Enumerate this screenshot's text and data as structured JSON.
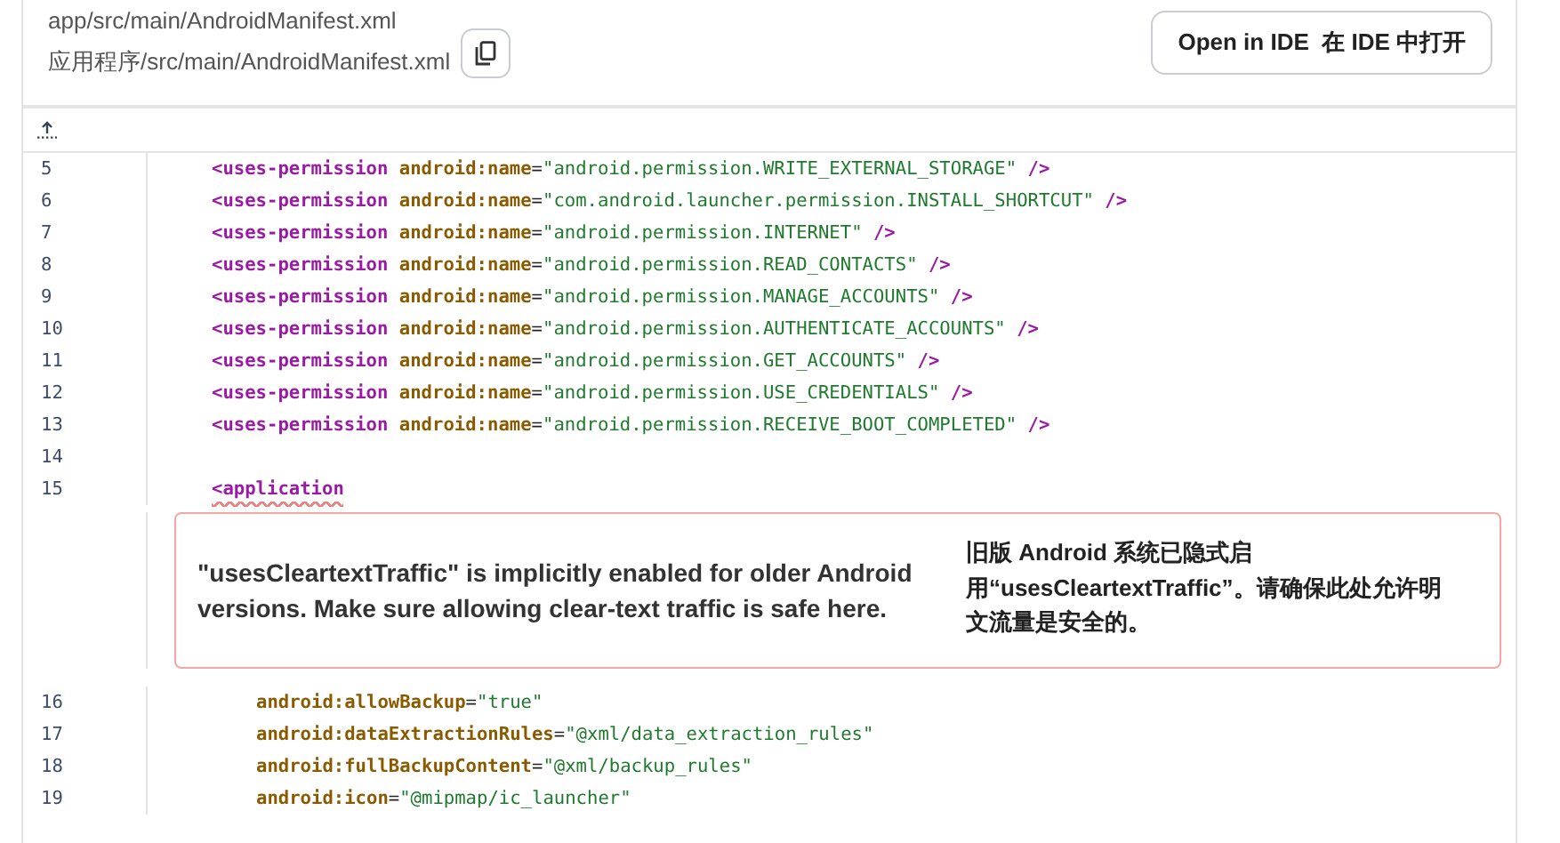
{
  "header": {
    "path": "app/src/main/AndroidManifest.xml",
    "path_translated": "应用程序/src/main/AndroidManifest.xml",
    "open_button": "Open in IDE  在 IDE 中打开"
  },
  "code": {
    "lines": [
      {
        "number": "5",
        "kind": "element",
        "tokens": [
          {
            "kind": "tag",
            "text": "<uses-permission"
          },
          {
            "kind": "attr",
            "text": " android:name"
          },
          {
            "kind": "punct",
            "text": "="
          },
          {
            "kind": "value",
            "text": "\"android.permission.WRITE_EXTERNAL_STORAGE\""
          },
          {
            "kind": "tag",
            "text": " />"
          }
        ]
      },
      {
        "number": "6",
        "kind": "element",
        "tokens": [
          {
            "kind": "tag",
            "text": "<uses-permission"
          },
          {
            "kind": "attr",
            "text": " android:name"
          },
          {
            "kind": "punct",
            "text": "="
          },
          {
            "kind": "value",
            "text": "\"com.android.launcher.permission.INSTALL_SHORTCUT\""
          },
          {
            "kind": "tag",
            "text": " />"
          }
        ]
      },
      {
        "number": "7",
        "kind": "element",
        "tokens": [
          {
            "kind": "tag",
            "text": "<uses-permission"
          },
          {
            "kind": "attr",
            "text": " android:name"
          },
          {
            "kind": "punct",
            "text": "="
          },
          {
            "kind": "value",
            "text": "\"android.permission.INTERNET\""
          },
          {
            "kind": "tag",
            "text": " />"
          }
        ]
      },
      {
        "number": "8",
        "kind": "element",
        "tokens": [
          {
            "kind": "tag",
            "text": "<uses-permission"
          },
          {
            "kind": "attr",
            "text": " android:name"
          },
          {
            "kind": "punct",
            "text": "="
          },
          {
            "kind": "value",
            "text": "\"android.permission.READ_CONTACTS\""
          },
          {
            "kind": "tag",
            "text": " />"
          }
        ]
      },
      {
        "number": "9",
        "kind": "element",
        "tokens": [
          {
            "kind": "tag",
            "text": "<uses-permission"
          },
          {
            "kind": "attr",
            "text": " android:name"
          },
          {
            "kind": "punct",
            "text": "="
          },
          {
            "kind": "value",
            "text": "\"android.permission.MANAGE_ACCOUNTS\""
          },
          {
            "kind": "tag",
            "text": " />"
          }
        ]
      },
      {
        "number": "10",
        "kind": "element",
        "tokens": [
          {
            "kind": "tag",
            "text": "<uses-permission"
          },
          {
            "kind": "attr",
            "text": " android:name"
          },
          {
            "kind": "punct",
            "text": "="
          },
          {
            "kind": "value",
            "text": "\"android.permission.AUTHENTICATE_ACCOUNTS\""
          },
          {
            "kind": "tag",
            "text": " />"
          }
        ]
      },
      {
        "number": "11",
        "kind": "element",
        "tokens": [
          {
            "kind": "tag",
            "text": "<uses-permission"
          },
          {
            "kind": "attr",
            "text": " android:name"
          },
          {
            "kind": "punct",
            "text": "="
          },
          {
            "kind": "value",
            "text": "\"android.permission.GET_ACCOUNTS\""
          },
          {
            "kind": "tag",
            "text": " />"
          }
        ]
      },
      {
        "number": "12",
        "kind": "element",
        "tokens": [
          {
            "kind": "tag",
            "text": "<uses-permission"
          },
          {
            "kind": "attr",
            "text": " android:name"
          },
          {
            "kind": "punct",
            "text": "="
          },
          {
            "kind": "value",
            "text": "\"android.permission.USE_CREDENTIALS\""
          },
          {
            "kind": "tag",
            "text": " />"
          }
        ]
      },
      {
        "number": "13",
        "kind": "element",
        "tokens": [
          {
            "kind": "tag",
            "text": "<uses-permission"
          },
          {
            "kind": "attr",
            "text": " android:name"
          },
          {
            "kind": "punct",
            "text": "="
          },
          {
            "kind": "value",
            "text": "\"android.permission.RECEIVE_BOOT_COMPLETED\""
          },
          {
            "kind": "tag",
            "text": " />"
          }
        ]
      },
      {
        "number": "14",
        "kind": "element"
      },
      {
        "number": "15",
        "kind": "element",
        "tokens": [
          {
            "kind": "tag",
            "text": "<application",
            "error": true
          }
        ],
        "warning": {
          "message": "\"usesCleartextTraffic\" is implicitly enabled for older Android versions. Make sure allowing clear-text traffic is safe here.",
          "message_translated": "旧版 Android 系统已隐式启用“usesCleartextTraffic”。请确保此处允许明文流量是安全的。"
        }
      },
      {
        "number": "16",
        "kind": "attribute",
        "tokens": [
          {
            "kind": "attr",
            "text": "android:allowBackup"
          },
          {
            "kind": "punct",
            "text": "="
          },
          {
            "kind": "value",
            "text": "\"true\""
          }
        ]
      },
      {
        "number": "17",
        "kind": "attribute",
        "tokens": [
          {
            "kind": "attr",
            "text": "android:dataExtractionRules"
          },
          {
            "kind": "punct",
            "text": "="
          },
          {
            "kind": "value",
            "text": "\"@xml/data_extraction_rules\""
          }
        ]
      },
      {
        "number": "18",
        "kind": "attribute",
        "tokens": [
          {
            "kind": "attr",
            "text": "android:fullBackupContent"
          },
          {
            "kind": "punct",
            "text": "="
          },
          {
            "kind": "value",
            "text": "\"@xml/backup_rules\""
          }
        ]
      },
      {
        "number": "19",
        "kind": "attribute",
        "tokens": [
          {
            "kind": "attr",
            "text": "android:icon"
          },
          {
            "kind": "punct",
            "text": "="
          },
          {
            "kind": "value",
            "text": "\"@mipmap/ic_launcher\""
          }
        ]
      }
    ]
  }
}
